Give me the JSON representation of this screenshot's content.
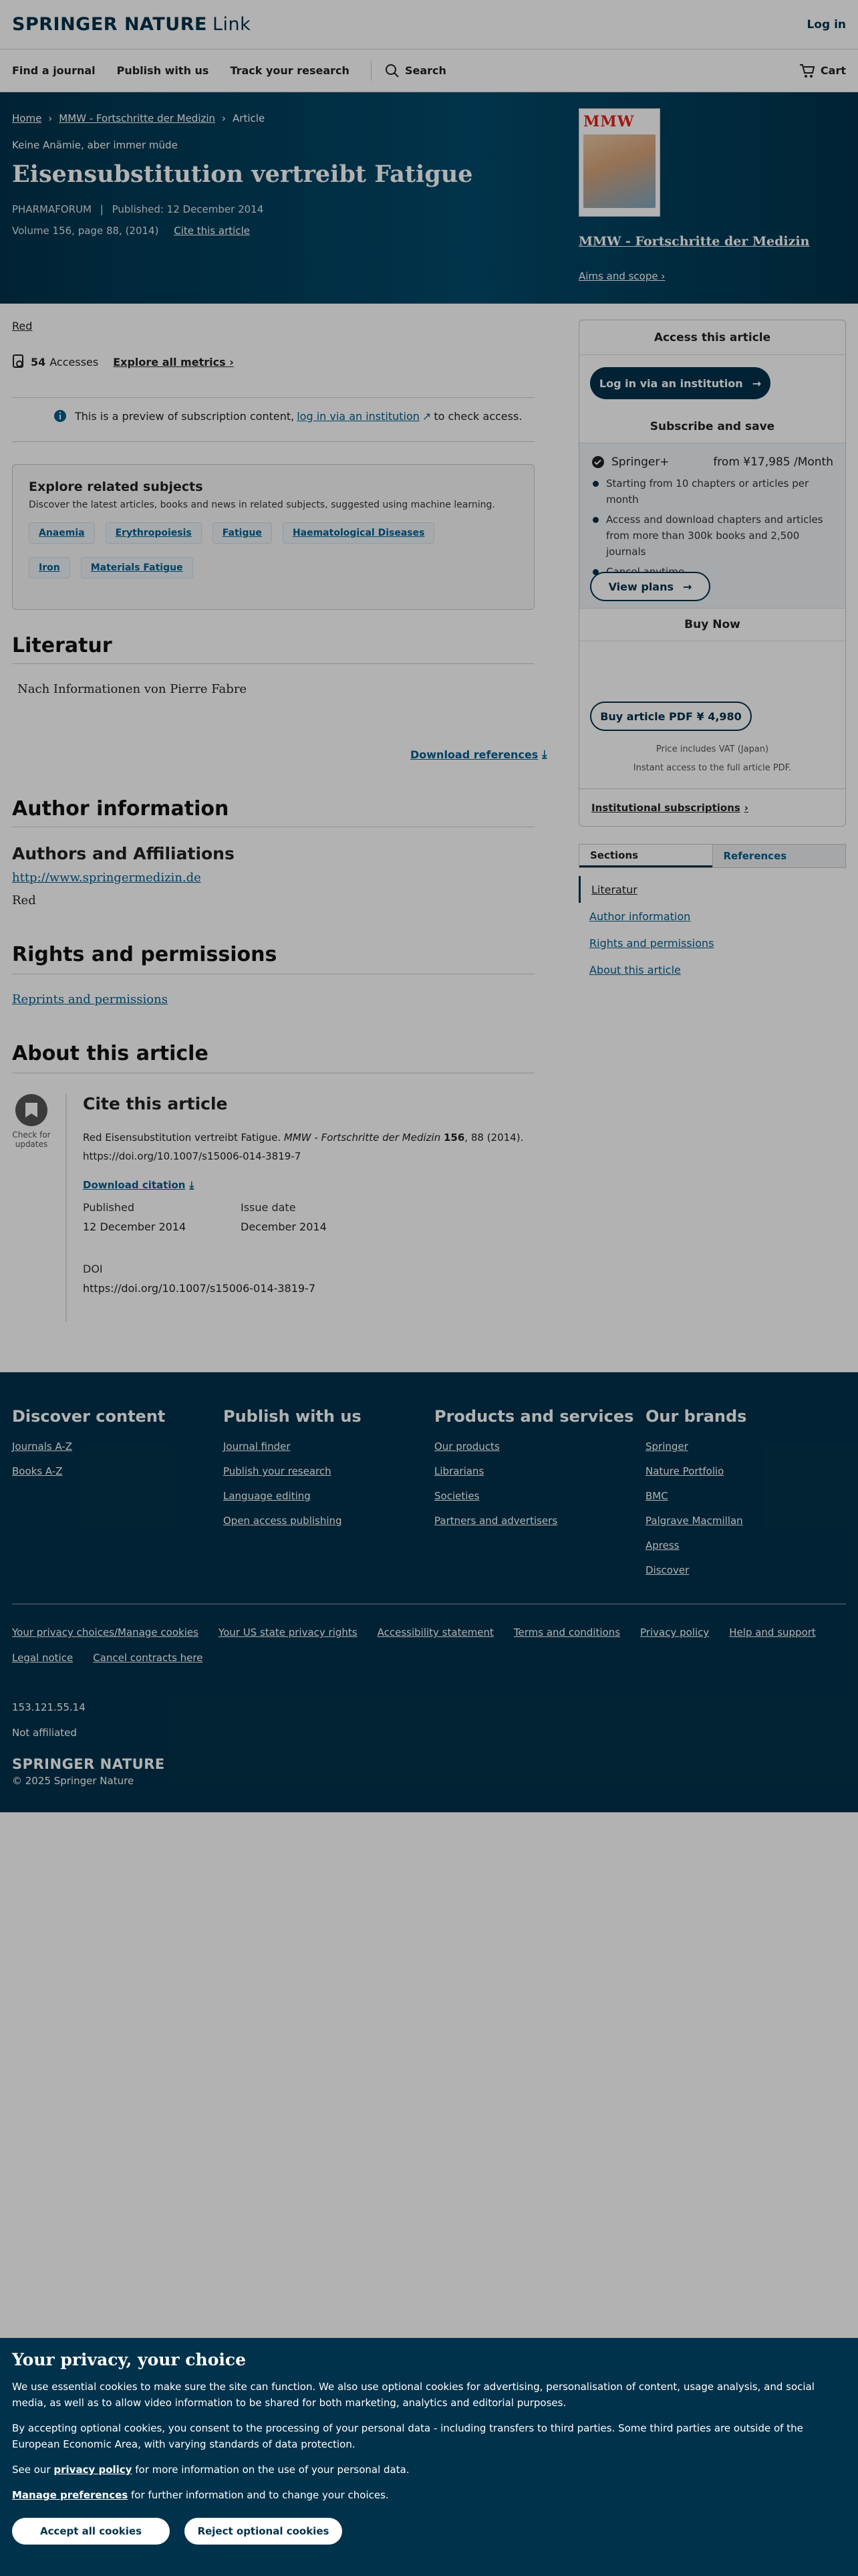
{
  "header": {
    "logo_brand": "SPRINGER NATURE",
    "logo_product": "Link",
    "login": "Log in"
  },
  "nav": {
    "items": [
      "Find a journal",
      "Publish with us",
      "Track your research"
    ],
    "search": "Search",
    "cart": "Cart"
  },
  "breadcrumb": {
    "home": "Home",
    "journal": "MMW - Fortschritte der Medizin",
    "current": "Article"
  },
  "article": {
    "subtitle": "Keine Anämie, aber immer müde",
    "title": "Eisensubstitution vertreibt Fatigue",
    "section": "PHARMAFORUM",
    "published": "Published: 12 December 2014",
    "volume": "Volume 156, page 88, (2014)",
    "cite_link": "Cite this article",
    "author": "Red",
    "accesses_count": "54",
    "accesses_label": "Accesses",
    "metrics_link": "Explore all metrics"
  },
  "journal": {
    "cover_text": "MMW",
    "name": "MMW - Fortschritte der Medizin",
    "aims": "Aims and scope"
  },
  "preview": {
    "text_before": "This is a preview of subscription content,",
    "link": "log in via an institution",
    "text_after": "to check access."
  },
  "related": {
    "title": "Explore related subjects",
    "desc": "Discover the latest articles, books and news in related subjects, suggested using machine learning.",
    "tags": [
      "Anaemia",
      "Erythropoiesis",
      "Fatigue",
      "Haematological Diseases",
      "Iron",
      "Materials Fatigue"
    ]
  },
  "literatur": {
    "heading": "Literatur",
    "text": "Nach Informationen von Pierre Fabre",
    "download": "Download references"
  },
  "author_info": {
    "heading": "Author information",
    "aff_heading": "Authors and Affiliations",
    "aff_link": "http://www.springermedizin.de",
    "aff_name": "Red"
  },
  "rights": {
    "heading": "Rights and permissions",
    "link": "Reprints and permissions"
  },
  "about": {
    "heading": "About this article",
    "cfu_line1": "Check for",
    "cfu_line2": "updates",
    "cite_heading": "Cite this article",
    "cite_plain": "Red Eisensubstitution vertreibt Fatigue.",
    "cite_journal": "MMW - Fortschritte der Medizin",
    "cite_vol": "156",
    "cite_rest": ", 88 (2014).",
    "cite_doi": "https://doi.org/10.1007/s15006-014-3819-7",
    "download_citation": "Download citation",
    "published_label": "Published",
    "published_value": "12 December 2014",
    "issue_label": "Issue date",
    "issue_value": "December 2014",
    "doi_label": "DOI",
    "doi_value": "https://doi.org/10.1007/s15006-014-3819-7"
  },
  "access": {
    "heading": "Access this article",
    "login_btn": "Log in via an institution",
    "sub_heading": "Subscribe and save",
    "plan_name": "Springer+",
    "plan_price": "from ¥17,985 /Month",
    "bullets": [
      "Starting from 10 chapters or articles per month",
      "Access and download chapters and articles from more than 300k books and 2,500 journals",
      "Cancel anytime"
    ],
    "view_plans": "View plans",
    "buy_heading": "Buy Now",
    "buy_btn": "Buy article PDF ¥ 4,980",
    "vat": "Price includes VAT (Japan)",
    "instant": "Instant access to the full article PDF.",
    "institutional": "Institutional subscriptions"
  },
  "sidetabs": {
    "sections": "Sections",
    "references": "References",
    "toc": [
      "Literatur",
      "Author information",
      "Rights and permissions",
      "About this article"
    ]
  },
  "footer": {
    "cols": [
      {
        "title": "Discover content",
        "links": [
          "Journals A-Z",
          "Books A-Z"
        ]
      },
      {
        "title": "Publish with us",
        "links": [
          "Journal finder",
          "Publish your research",
          "Language editing",
          "Open access publishing"
        ]
      },
      {
        "title": "Products and services",
        "links": [
          "Our products",
          "Librarians",
          "Societies",
          "Partners and advertisers"
        ]
      },
      {
        "title": "Our brands",
        "links": [
          "Springer",
          "Nature Portfolio",
          "BMC",
          "Palgrave Macmillan",
          "Apress",
          "Discover"
        ]
      }
    ],
    "legal": [
      "Your privacy choices/Manage cookies",
      "Your US state privacy rights",
      "Accessibility statement",
      "Terms and conditions",
      "Privacy policy",
      "Help and support",
      "Legal notice",
      "Cancel contracts here"
    ],
    "ip": "153.121.55.14",
    "affiliation": "Not affiliated",
    "logo": "SPRINGER NATURE",
    "copyright": "© 2025 Springer Nature"
  },
  "cookie": {
    "title": "Your privacy, your choice",
    "p1": "We use essential cookies to make sure the site can function. We also use optional cookies for advertising, personalisation of content, usage analysis, and social media, as well as to allow video information to be shared for both marketing, analytics and editorial purposes.",
    "p2": "By accepting optional cookies, you consent to the processing of your personal data - including transfers to third parties. Some third parties are outside of the European Economic Area, with varying standards of data protection.",
    "p3_before": "See our",
    "p3_link": "privacy policy",
    "p3_after": "for more information on the use of your personal data.",
    "p4_link": "Manage preferences",
    "p4_after": "for further information and to change your choices.",
    "accept": "Accept all cookies",
    "reject": "Reject optional cookies"
  },
  "colors": {
    "brand": "#01324b",
    "link": "#025e8d"
  }
}
